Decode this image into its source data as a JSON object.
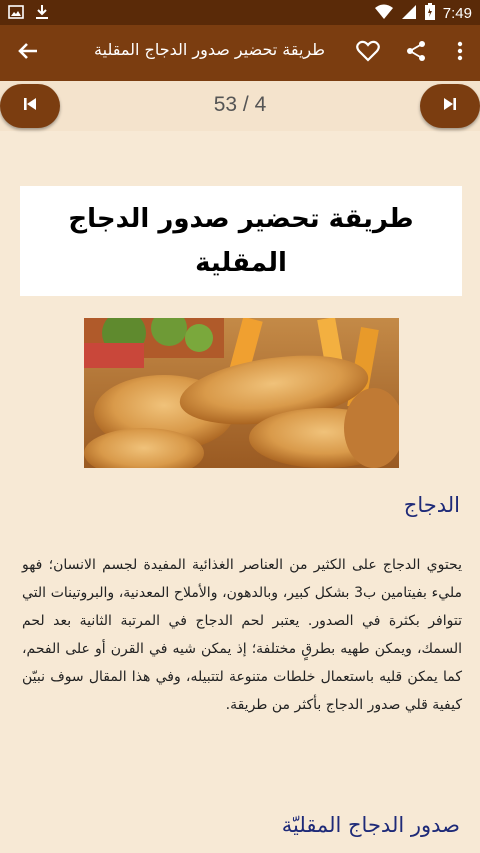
{
  "status_bar": {
    "time": "7:49",
    "icons": [
      "image-icon",
      "download-icon",
      "wifi-icon",
      "signal-icon",
      "battery-icon"
    ]
  },
  "app_bar": {
    "title": "طريقة تحضير صدور الدجاج المقلية",
    "icons": [
      "back-arrow-icon",
      "heart-icon",
      "share-icon",
      "more-vert-icon"
    ]
  },
  "pager": {
    "indicator": "53 / 4",
    "icons": [
      "skip-previous-icon",
      "skip-next-icon"
    ]
  },
  "article": {
    "title": "طريقة تحضير صدور الدجاج المقلية",
    "heading_1": "الدجاج",
    "paragraph_1": "يحتوي الدجاج على الكثير من العناصر الغذائية المفيدة لجسم الانسان؛ فهو مليء بفيتامين ب3 بشكل كبير، وبالدهون، والأملاح المعدنية، والبروتينات التي تتوافر بكثرة في الصدور. يعتبر لحم الدجاج في المرتبة الثانية بعد لحم السمك، ويمكن طهيه بطرقٍ مختلفة؛ إذ يمكن شيه في القرن أو على الفحم، كما يمكن قليه باستعمال خلطات متنوعة لتتبيله، وفي هذا المقال سوف نبيّن كيفية قلي صدور الدجاج بأكثر من طريقة.",
    "heading_2": "صدور الدجاج المقليّة"
  },
  "colors": {
    "status_bar": "#5a2a08",
    "app_bar": "#7b3d10",
    "background": "#f7e9d5",
    "heading": "#1e2a78"
  }
}
